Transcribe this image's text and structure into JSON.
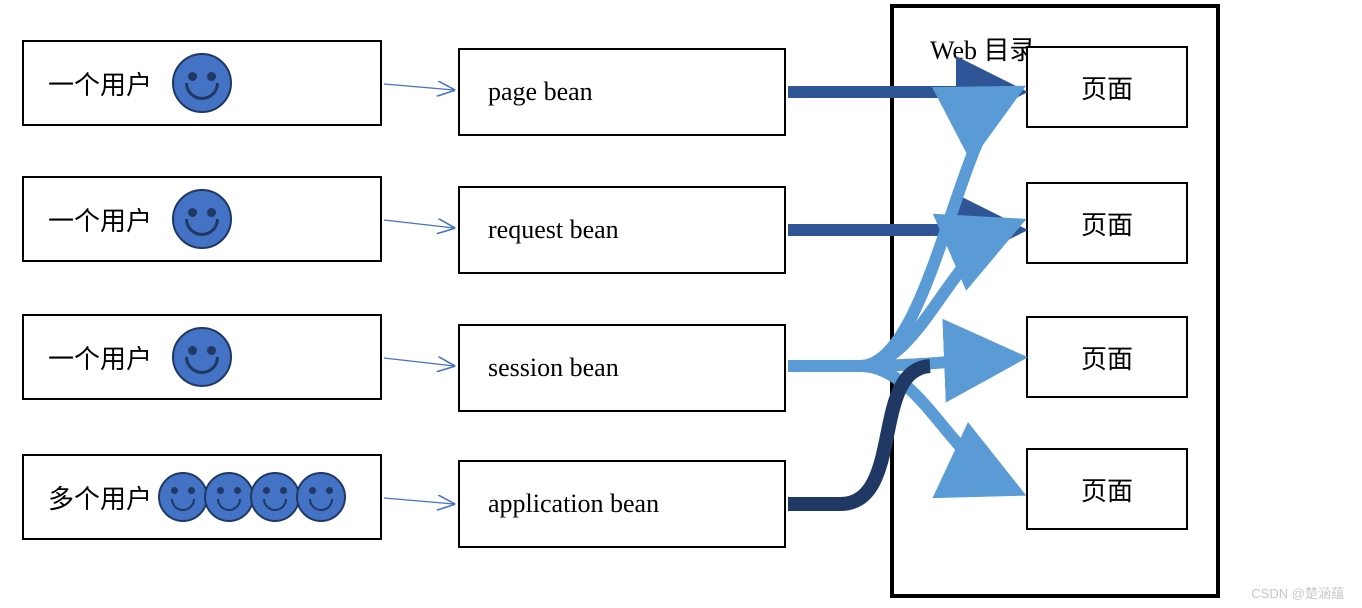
{
  "users": {
    "row1": "一个用户",
    "row2": "一个用户",
    "row3": "一个用户",
    "row4": "多个用户"
  },
  "beans": {
    "row1": "page bean",
    "row2": "request bean",
    "row3": "session bean",
    "row4": "application bean"
  },
  "container": {
    "label": "Web 目录"
  },
  "pages": {
    "p1": "页面",
    "p2": "页面",
    "p3": "页面",
    "p4": "页面"
  },
  "watermark": "CSDN @楚涵蕴"
}
